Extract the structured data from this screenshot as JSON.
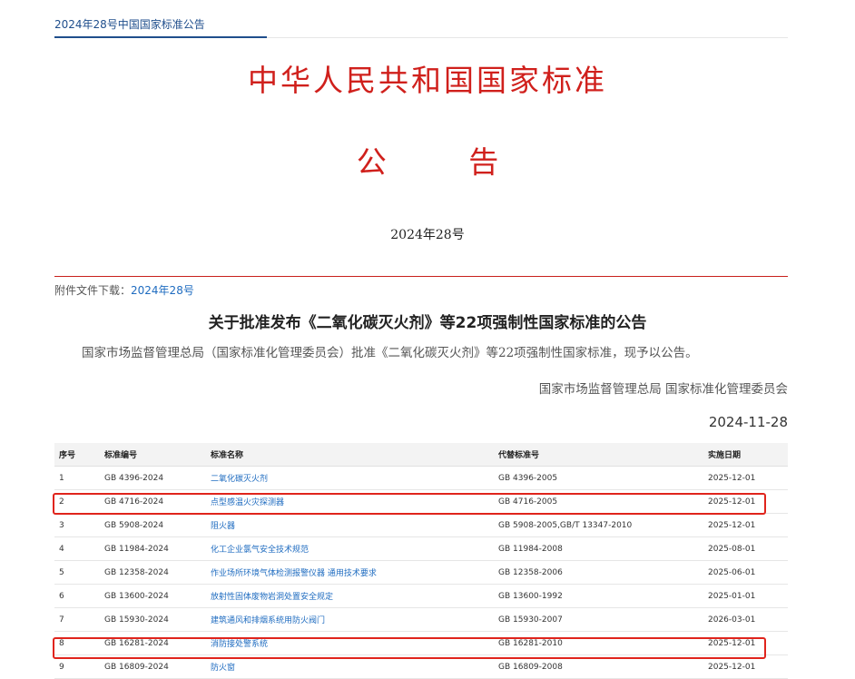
{
  "header": {
    "tab_label": "2024年28号中国国家标准公告",
    "main_title": "中华人民共和国国家标准",
    "sub_title": "公 告",
    "issue_no": "2024年28号"
  },
  "attachment": {
    "label": "附件文件下载：",
    "link": "2024年28号"
  },
  "notice": {
    "title": "关于批准发布《二氧化碳灭火剂》等22项强制性国家标准的公告",
    "body": "国家市场监督管理总局（国家标准化管理委员会）批准《二氧化碳灭火剂》等22项强制性国家标准，现予以公告。",
    "signature": "国家市场监督管理总局 国家标准化管理委员会",
    "date": "2024-11-28"
  },
  "table": {
    "headers": [
      "序号",
      "标准编号",
      "标准名称",
      "代替标准号",
      "实施日期"
    ],
    "rows": [
      [
        "1",
        "GB 4396-2024",
        "二氧化碳灭火剂",
        "GB 4396-2005",
        "2025-12-01"
      ],
      [
        "2",
        "GB 4716-2024",
        "点型感温火灾探测器",
        "GB 4716-2005",
        "2025-12-01"
      ],
      [
        "3",
        "GB 5908-2024",
        "阻火器",
        "GB 5908-2005,GB/T 13347-2010",
        "2025-12-01"
      ],
      [
        "4",
        "GB 11984-2024",
        "化工企业氯气安全技术规范",
        "GB 11984-2008",
        "2025-08-01"
      ],
      [
        "5",
        "GB 12358-2024",
        "作业场所环境气体检测报警仪器 通用技术要求",
        "GB 12358-2006",
        "2025-06-01"
      ],
      [
        "6",
        "GB 13600-2024",
        "放射性固体废物岩洞处置安全规定",
        "GB 13600-1992",
        "2025-01-01"
      ],
      [
        "7",
        "GB 15930-2024",
        "建筑通风和排烟系统用防火阀门",
        "GB 15930-2007",
        "2026-03-01"
      ],
      [
        "8",
        "GB 16281-2024",
        "消防接处警系统",
        "GB 16281-2010",
        "2025-12-01"
      ],
      [
        "9",
        "GB 16809-2024",
        "防火窗",
        "GB 16809-2008",
        "2025-12-01"
      ]
    ]
  },
  "colors": {
    "title_red": "#d0201c",
    "link_blue": "#1f6cc0",
    "highlight_red": "#e0241c"
  }
}
